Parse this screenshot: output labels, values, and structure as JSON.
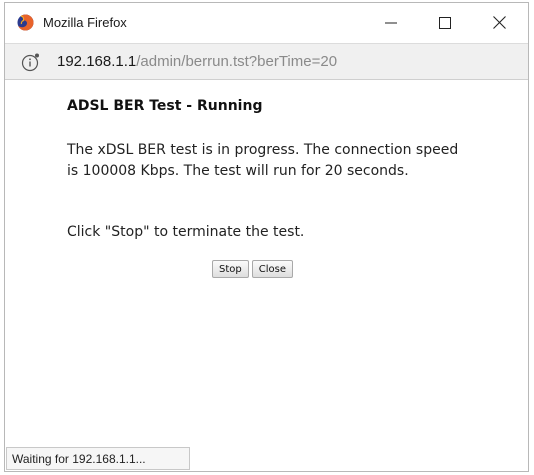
{
  "window": {
    "title": "Mozilla Firefox",
    "icon": "firefox-logo-icon",
    "controls": [
      "minimize-icon",
      "maximize-icon",
      "close-icon"
    ]
  },
  "address_bar": {
    "info_icon": "info-icon",
    "url_host": "192.168.1.1",
    "url_path": "/admin/berrun.tst?berTime=20"
  },
  "content": {
    "heading": "ADSL BER Test - Running",
    "message": "The xDSL BER test is in progress. The connection speed is 100008 Kbps. The test will run for 20 seconds.",
    "instruction": "Click \"Stop\" to terminate the test.",
    "stop_label": "Stop",
    "close_label": "Close"
  },
  "status_bar": {
    "text": "Waiting for 192.168.1.1..."
  },
  "colors": {
    "url_path": "#8a8a8a",
    "address_bar_bg": "#f0f0f0"
  }
}
